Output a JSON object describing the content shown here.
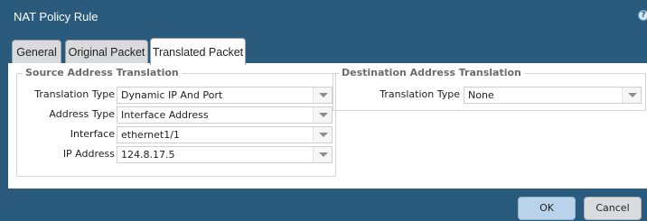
{
  "dialog": {
    "title": "NAT Policy Rule",
    "help_icon": "help-circle-icon"
  },
  "tabs": [
    {
      "label": "General",
      "active": false
    },
    {
      "label": "Original Packet",
      "active": false
    },
    {
      "label": "Translated Packet",
      "active": true
    }
  ],
  "source_translation": {
    "legend": "Source Address Translation",
    "fields": [
      {
        "label": "Translation Type",
        "value": "Dynamic IP And Port"
      },
      {
        "label": "Address Type",
        "value": "Interface Address"
      },
      {
        "label": "Interface",
        "value": "ethernet1/1"
      },
      {
        "label": "IP Address",
        "value": "124.8.17.5"
      }
    ]
  },
  "destination_translation": {
    "legend": "Destination Address Translation",
    "fields": [
      {
        "label": "Translation Type",
        "value": "None"
      }
    ]
  },
  "footer": {
    "ok_label": "OK",
    "cancel_label": "Cancel"
  },
  "colors": {
    "title_bar": "#2a5b7c",
    "ok_button": "#b9d4ea",
    "cancel_button": "#d9dcdf"
  }
}
